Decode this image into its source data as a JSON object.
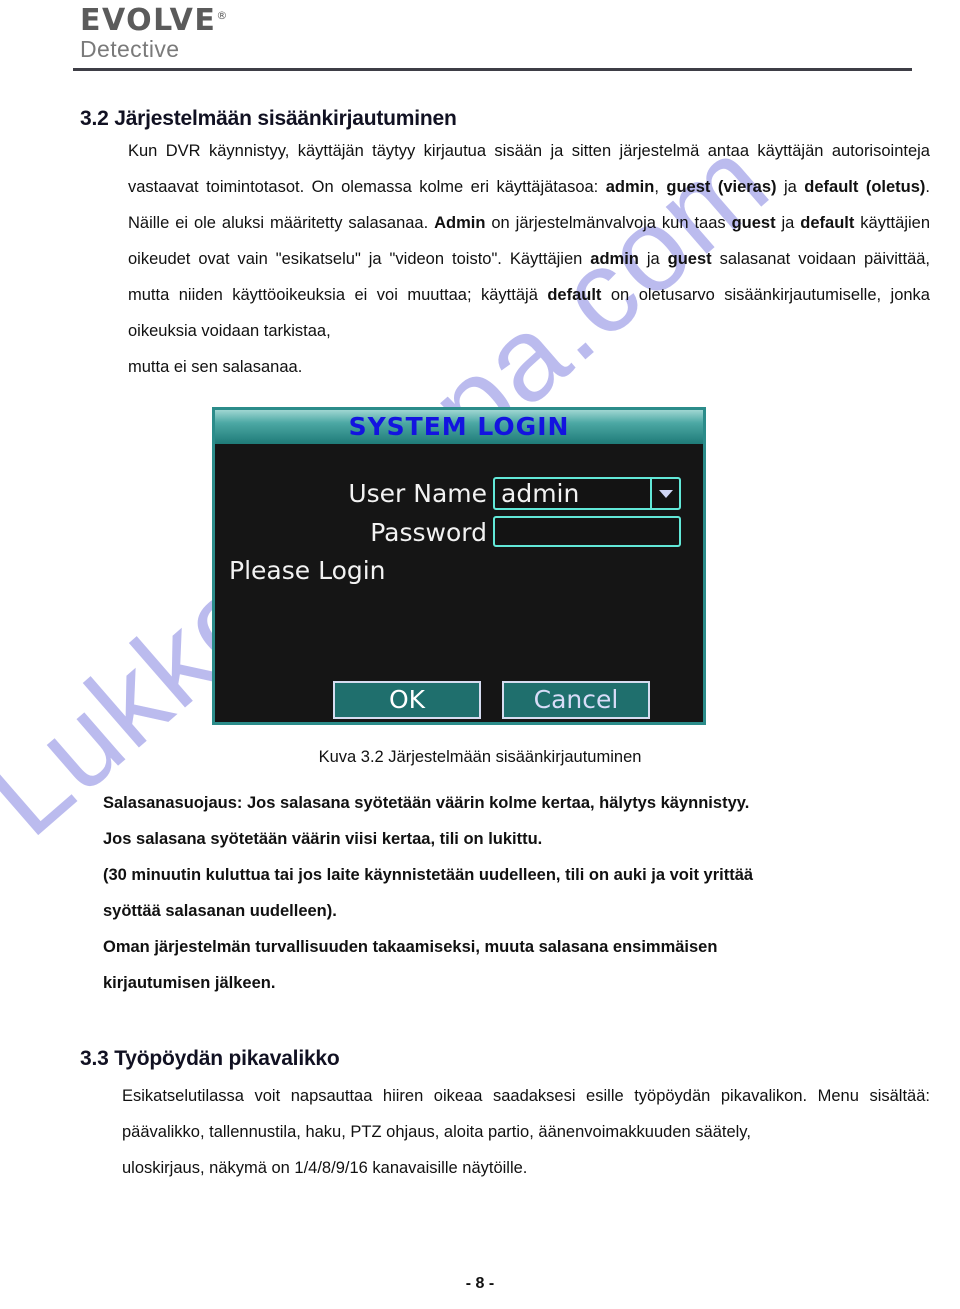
{
  "header": {
    "brand": "EVOLVE",
    "brand_mark": "®",
    "product": "Detective"
  },
  "watermark": {
    "text": "Lukkokauppa.com",
    "color": "#b0b0ec"
  },
  "sections": {
    "heading_32": "3.2 Järjestelmään sisäänkirjautuminen",
    "heading_33": "3.3 Työpöydän pikavalikko"
  },
  "paragraphs": {
    "intro_line1": "Kun DVR käynnistyy, käyttäjän täytyy kirjautua sisään ja sitten järjestelmä antaa käyttäjän",
    "intro_line2_a": "autorisointeja vastaavat toimintotasot. On olemassa kolme eri käyttäjätasoa: ",
    "intro_line2_b": "admin",
    "intro_line2_c": ", ",
    "intro_line2_d": "guest",
    "intro_line3_a": "(vieras)",
    "intro_line3_b": " ja ",
    "intro_line3_c": "default (oletus)",
    "intro_line3_d": ". Näille ei ole aluksi määritetty salasanaa. ",
    "intro_line3_e": "Admin",
    "intro_line3_f": " on",
    "intro_line4_a": "järjestelmänvalvoja kun taas ",
    "intro_line4_b": "guest",
    "intro_line4_c": " ja ",
    "intro_line4_d": "default",
    "intro_line4_e": " käyttäjien oikeudet ovat vain \"esikatselu\" ja \"videon",
    "intro_line5_a": "toisto\". Käyttäjien ",
    "intro_line5_b": "admin",
    "intro_line5_c": " ja ",
    "intro_line5_d": "guest",
    "intro_line5_e": " salasanat voidaan päivittää, mutta niiden käyttöoikeuksia ei voi",
    "intro_line6_a": "muuttaa; käyttäjä ",
    "intro_line6_b": "default",
    "intro_line6_c": " on oletusarvo sisäänkirjautumiselle, jonka oikeuksia voidaan tarkistaa,",
    "intro_line7": "mutta ei sen salasanaa.",
    "warning_line1": "Salasanasuojaus: Jos salasana syötetään väärin kolme kertaa, hälytys käynnistyy.",
    "warning_line2": "Jos salasana syötetään väärin viisi kertaa, tili on lukittu.",
    "warning_line3": "(30 minuutin kuluttua tai jos laite käynnistetään uudelleen, tili on auki ja voit yrittää",
    "warning_line4": "syöttää salasanan uudelleen).",
    "warning_line5": "Oman järjestelmän turvallisuuden takaamiseksi, muuta salasana ensimmäisen",
    "warning_line6": "kirjautumisen jälkeen.",
    "desktop_line1": "Esikatselutilassa voit napsauttaa hiiren oikeaa saadaksesi esille työpöydän pikavalikon. Menu",
    "desktop_line2": "sisältää: päävalikko, tallennustila, haku, PTZ ohjaus, aloita partio, äänenvoimakkuuden säätely,",
    "desktop_line3": "uloskirjaus, näkymä on 1/4/8/9/16 kanavaisille näytöille."
  },
  "figure": {
    "caption": "Kuva 3.2 Järjestelmään sisäänkirjautuminen",
    "dialog": {
      "title": "SYSTEM LOGIN",
      "username_label": "User Name",
      "username_value": "admin",
      "password_label": "Password",
      "password_value": "",
      "status_text": "Please Login",
      "ok_label": "OK",
      "cancel_label": "Cancel",
      "title_color": "#1313e0",
      "accent_color": "#62e8d8",
      "titlebar_color": "#2b8c8a"
    }
  },
  "footer": {
    "page_number": "- 8 -"
  }
}
